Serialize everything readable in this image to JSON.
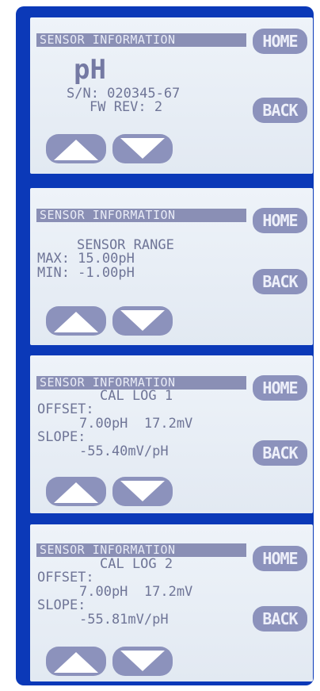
{
  "colors": {
    "frame": "#0b39b8",
    "screen": "#e8eef6",
    "header_bar": "#8a8fb5",
    "lcd_text": "#6f7597",
    "button": "#8c92bc"
  },
  "screens": [
    {
      "title": "SENSOR INFORMATION",
      "home": "HOME",
      "back": "BACK",
      "heading": "pH",
      "sn": "S/N: 020345-67",
      "fw": "FW REV: 2",
      "up_icon": "up-arrow-icon",
      "down_icon": "down-arrow-icon"
    },
    {
      "title": "SENSOR INFORMATION",
      "home": "HOME",
      "back": "BACK",
      "subtitle": "SENSOR RANGE",
      "max": "MAX: 15.00pH",
      "min": "MIN: -1.00pH"
    },
    {
      "title": "SENSOR INFORMATION",
      "home": "HOME",
      "back": "BACK",
      "subtitle": "CAL LOG 1",
      "offset_label": "OFFSET:",
      "offset_value": "7.00pH  17.2mV",
      "slope_label": "SLOPE:",
      "slope_value": "-55.40mV/pH"
    },
    {
      "title": "SENSOR INFORMATION",
      "home": "HOME",
      "back": "BACK",
      "subtitle": "CAL LOG 2",
      "offset_label": "OFFSET:",
      "offset_value": "7.00pH  17.2mV",
      "slope_label": "SLOPE:",
      "slope_value": "-55.81mV/pH"
    }
  ]
}
